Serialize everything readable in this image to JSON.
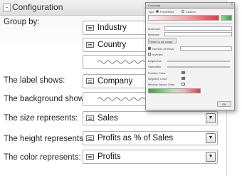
{
  "panel": {
    "title": "Configuration",
    "toggle_glyph": "−",
    "group_by_label": "Group by:",
    "group_by": [
      "Industry",
      "Country"
    ],
    "label_shows_label": "The label shows:",
    "label_shows_value": "Company",
    "background_shows_label": "The background shows:",
    "size_label": "The size represents:",
    "size_value": "Sales",
    "height_label": "The height represents:",
    "height_value": "Profits as % of Sales",
    "color_label": "The color represents:",
    "color_value": "Profits",
    "dropdown_glyph": "▼"
  },
  "colors": {
    "dialog_red": "#e23b3b",
    "dialog_green": "#3aa33a"
  },
  "dialog": {
    "title": "Colormap",
    "close_glyph": "×",
    "type_label": "Type",
    "type_options": [
      "Predefined",
      "Custom"
    ],
    "fields": [
      "Maximum",
      "Minimum",
      "Reset to full range",
      "Number of Steps",
      "Inverted",
      "Brightness",
      "Saturation",
      "Positive Color",
      "Negative Color",
      "Missing Values Color"
    ],
    "ok_label": "OK"
  },
  "icons": {
    "field": "field-icon",
    "dropdown": "dropdown-arrow-icon"
  }
}
